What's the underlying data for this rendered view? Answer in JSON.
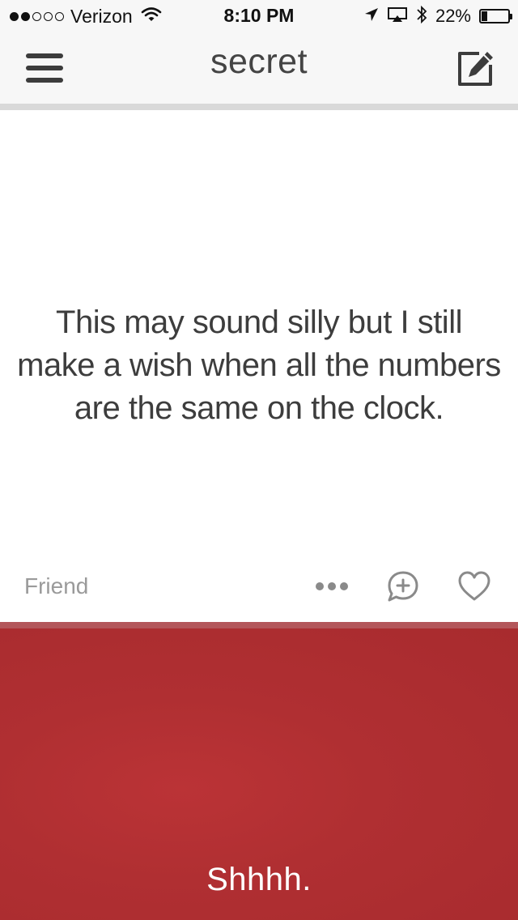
{
  "status_bar": {
    "carrier": "Verizon",
    "signal_strength": 2,
    "signal_total": 5,
    "time": "8:10 PM",
    "battery_percent": "22%",
    "battery_level": 0.22
  },
  "header": {
    "title": "secret"
  },
  "post": {
    "text": "This may sound silly but I still make a wish when all the numbers are the same on the clock.",
    "author": "Friend"
  },
  "footer": {
    "label": "Shhhh."
  },
  "colors": {
    "accent_red": "#b02f32",
    "text_dark": "#3d3d3d",
    "muted": "#9a9a9a"
  }
}
